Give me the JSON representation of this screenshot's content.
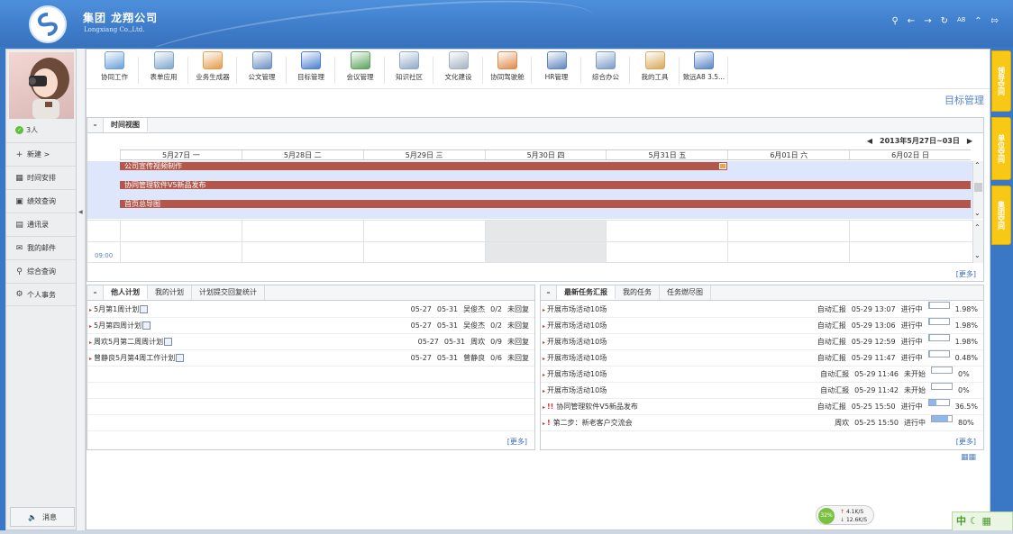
{
  "header": {
    "title": "集团  龙翔公司",
    "subtitle": "Longxiang Co.,Ltd.",
    "icons": [
      "search-icon",
      "back-icon",
      "forward-icon",
      "refresh-icon",
      "font-size-icon",
      "collapse-icon",
      "logout-icon"
    ],
    "font_label": "A8"
  },
  "left_nav": {
    "online_count": "3人",
    "items": [
      {
        "label": "新建 >",
        "icon": "plus-icon"
      },
      {
        "label": "时间安排",
        "icon": "calendar-icon"
      },
      {
        "label": "绩效查询",
        "icon": "performance-icon"
      },
      {
        "label": "通讯录",
        "icon": "address-book-icon"
      },
      {
        "label": "我的邮件",
        "icon": "mail-icon"
      },
      {
        "label": "综合查询",
        "icon": "search-icon"
      },
      {
        "label": "个人事务",
        "icon": "gear-icon"
      }
    ],
    "message_label": "消息"
  },
  "toolbar": {
    "items": [
      {
        "label": "协同工作",
        "color": "#6aa0d8"
      },
      {
        "label": "表单应用",
        "color": "#7ea7cf"
      },
      {
        "label": "业务生成器",
        "color": "#e59b4a"
      },
      {
        "label": "公文管理",
        "color": "#6b8fc2"
      },
      {
        "label": "目标管理",
        "color": "#4b7fd0"
      },
      {
        "label": "会议管理",
        "color": "#5ba35b"
      },
      {
        "label": "知识社区",
        "color": "#8fa9c9"
      },
      {
        "label": "文化建设",
        "color": "#a5b3c2"
      },
      {
        "label": "协同驾驶舱",
        "color": "#e08a4a"
      },
      {
        "label": "HR管理",
        "color": "#5f86c0"
      },
      {
        "label": "综合办公",
        "color": "#7a9bc8"
      },
      {
        "label": "我的工具",
        "color": "#d8a95a"
      },
      {
        "label": "致远A8 3.5...",
        "color": "#5a86c5"
      }
    ]
  },
  "page_title": "目标管理",
  "time_view": {
    "tab": "时间视图",
    "range": "2013年5月27日~03日",
    "days": [
      "5月27日 一",
      "5月28日 二",
      "5月29日 三",
      "5月30日 四",
      "5月31日 五",
      "6月01日 六",
      "6月02日 日"
    ],
    "bars": [
      {
        "label": "公司宣传视频制作",
        "span_days": 5,
        "flag": true
      },
      {
        "label": "协同管理软件V5新品发布",
        "span_days": 7,
        "flag": false
      },
      {
        "label": "首页总导图",
        "span_days": 7,
        "flag": false
      }
    ],
    "time_label": "09:00",
    "more": "[更多]"
  },
  "plans": {
    "tabs": [
      "他人计划",
      "我的计划",
      "计划提交回复统计"
    ],
    "rows": [
      {
        "title": "5月第1周计划",
        "start": "05-27",
        "end": "05-31",
        "owner": "吴俊杰",
        "ratio": "0/2",
        "status": "未回复"
      },
      {
        "title": "5月第四周计划",
        "start": "05-27",
        "end": "05-31",
        "owner": "吴俊杰",
        "ratio": "0/2",
        "status": "未回复"
      },
      {
        "title": "周欢5月第二周周计划",
        "start": "05-27",
        "end": "05-31",
        "owner": "周欢",
        "ratio": "0/9",
        "status": "未回复"
      },
      {
        "title": "曾静良5月第4周工作计划",
        "start": "05-27",
        "end": "05-31",
        "owner": "曾静良",
        "ratio": "0/6",
        "status": "未回复"
      }
    ],
    "more": "[更多]"
  },
  "reports": {
    "tabs": [
      "最新任务汇报",
      "我的任务",
      "任务燃尽图"
    ],
    "rows": [
      {
        "title": "开展市场活动10场",
        "source": "自动汇报",
        "time": "05-29 13:07",
        "state": "进行中",
        "progress": 1.98,
        "pct": "1.98%",
        "prio": ""
      },
      {
        "title": "开展市场活动10场",
        "source": "自动汇报",
        "time": "05-29 13:06",
        "state": "进行中",
        "progress": 1.98,
        "pct": "1.98%",
        "prio": ""
      },
      {
        "title": "开展市场活动10场",
        "source": "自动汇报",
        "time": "05-29 12:59",
        "state": "进行中",
        "progress": 1.98,
        "pct": "1.98%",
        "prio": ""
      },
      {
        "title": "开展市场活动10场",
        "source": "自动汇报",
        "time": "05-29 11:47",
        "state": "进行中",
        "progress": 0.48,
        "pct": "0.48%",
        "prio": ""
      },
      {
        "title": "开展市场活动10场",
        "source": "自动汇报",
        "time": "05-29 11:46",
        "state": "未开始",
        "progress": 0,
        "pct": "0%",
        "prio": ""
      },
      {
        "title": "开展市场活动10场",
        "source": "自动汇报",
        "time": "05-29 11:42",
        "state": "未开始",
        "progress": 0,
        "pct": "0%",
        "prio": ""
      },
      {
        "title": "协同管理软件V5新品发布",
        "source": "自动汇报",
        "time": "05-25 15:50",
        "state": "进行中",
        "progress": 36.5,
        "pct": "36.5%",
        "prio": "!!"
      },
      {
        "title": "第二步：新老客户交流会",
        "source": "周欢",
        "time": "05-25 15:50",
        "state": "进行中",
        "progress": 80,
        "pct": "80%",
        "prio": "!"
      }
    ],
    "more": "[更多]"
  },
  "right_tabs": [
    "领导空间",
    "单位空间",
    "集团空间"
  ],
  "speed": {
    "percent": "32%",
    "up": "4.1K/S",
    "down": "12.6K/S"
  },
  "ime": "中",
  "colors": {
    "accent": "#3e7cc9",
    "bar": "#b4574b",
    "band": "#dde6fb",
    "side_tab": "#f7c815"
  }
}
